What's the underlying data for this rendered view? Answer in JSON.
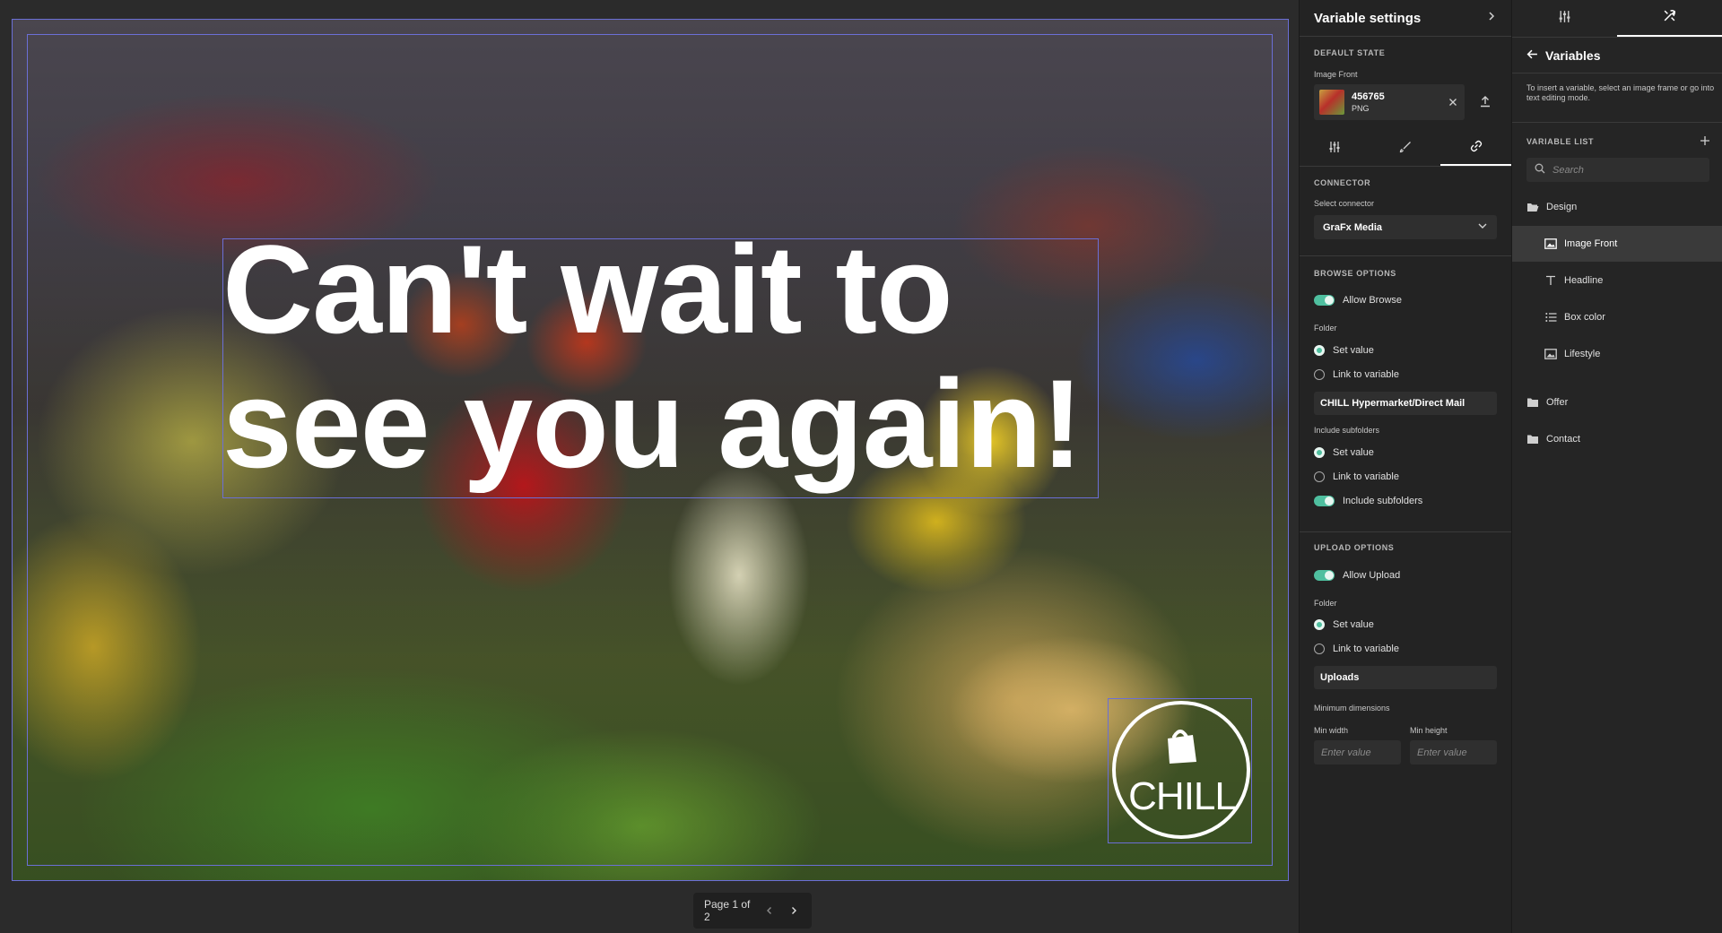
{
  "canvas": {
    "headline_text": "Can't wait to\nsee you again!",
    "logo_text": "CHILL",
    "pager": {
      "label": "Page 1 of 2"
    }
  },
  "settings": {
    "title": "Variable settings",
    "default_state": {
      "section": "DEFAULT STATE",
      "field_label": "Image Front",
      "image_name": "456765",
      "image_type": "PNG"
    },
    "connector": {
      "section": "CONNECTOR",
      "select_label": "Select connector",
      "selected": "GraFx Media"
    },
    "browse": {
      "section": "BROWSE OPTIONS",
      "allow_label": "Allow Browse",
      "folder_label": "Folder",
      "set_value": "Set value",
      "link_variable": "Link to variable",
      "folder_value": "CHILL Hypermarket/Direct Mail",
      "subfolders_label": "Include subfolders",
      "sub_set_value": "Set value",
      "sub_link_variable": "Link to variable",
      "include_subfolders": "Include subfolders"
    },
    "upload": {
      "section": "UPLOAD OPTIONS",
      "allow_label": "Allow Upload",
      "folder_label": "Folder",
      "set_value": "Set value",
      "link_variable": "Link to variable",
      "folder_value": "Uploads",
      "min_dims": "Minimum dimensions",
      "min_width_label": "Min width",
      "min_height_label": "Min height",
      "min_width_placeholder": "Enter value",
      "min_height_placeholder": "Enter value"
    }
  },
  "variables": {
    "title": "Variables",
    "hint": "To insert a variable, select an image frame or go into text editing mode.",
    "list_label": "VARIABLE LIST",
    "search_placeholder": "Search",
    "items": [
      {
        "label": "Design",
        "kind": "folder-open"
      },
      {
        "label": "Image Front",
        "kind": "image",
        "selected": true
      },
      {
        "label": "Headline",
        "kind": "text"
      },
      {
        "label": "Box color",
        "kind": "list"
      },
      {
        "label": "Lifestyle",
        "kind": "image"
      },
      {
        "label": "Offer",
        "kind": "folder"
      },
      {
        "label": "Contact",
        "kind": "folder"
      }
    ]
  },
  "colors": {
    "frame_outline": "#6b6fd6",
    "toggle_on": "#4fbf9f",
    "panel_bg": "#232323"
  }
}
